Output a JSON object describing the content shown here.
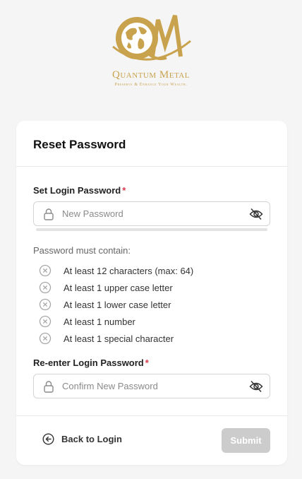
{
  "brand": {
    "name": "Quantum Metal",
    "tagline": "Preserve & Enhance Your Wealth.",
    "logo_icon": "qm-globe-logo",
    "color": "#c9a24d"
  },
  "card": {
    "title": "Reset Password"
  },
  "password_field": {
    "label": "Set Login Password",
    "required_marker": "*",
    "placeholder": "New Password",
    "value": "",
    "strength": 0
  },
  "rules": {
    "title": "Password must contain:",
    "items": [
      {
        "text": "At least 12 characters (max: 64)",
        "met": false
      },
      {
        "text": "At least 1 upper case letter",
        "met": false
      },
      {
        "text": "At least 1 lower case letter",
        "met": false
      },
      {
        "text": "At least 1 number",
        "met": false
      },
      {
        "text": "At least 1 special character",
        "met": false
      }
    ]
  },
  "confirm_field": {
    "label": "Re-enter Login Password",
    "required_marker": "*",
    "placeholder": "Confirm New Password",
    "value": ""
  },
  "footer": {
    "back_label": "Back to Login",
    "submit_label": "Submit",
    "submit_enabled": false
  },
  "icons": {
    "lock": "lock-icon",
    "eye": "eye-off-icon",
    "rule": "circle-x-icon",
    "back": "circle-arrow-left-icon"
  }
}
